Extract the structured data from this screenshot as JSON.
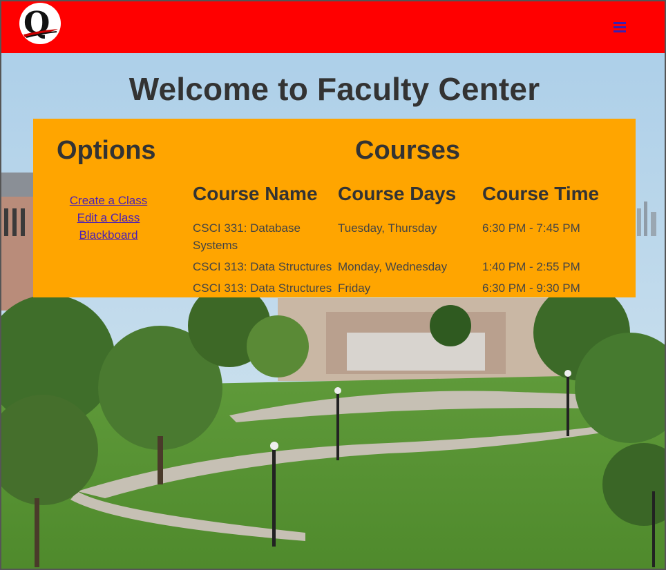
{
  "header": {
    "logo_letter": "Q",
    "menu_icon": "hamburger-menu-icon",
    "bar_color": "#ff0000"
  },
  "main": {
    "title": "Welcome to Faculty Center"
  },
  "options": {
    "title": "Options",
    "links": [
      "Create a Class",
      "Edit a Class",
      "Blackboard"
    ]
  },
  "courses": {
    "title": "Courses",
    "columns": [
      "Course Name",
      "Course Days",
      "Course Time"
    ],
    "rows": [
      [
        "CSCI 331: Database Systems",
        "Tuesday, Thursday",
        "6:30 PM - 7:45 PM"
      ],
      [
        "CSCI 313: Data Structures",
        "Monday, Wednesday",
        "1:40 PM - 2:55 PM"
      ],
      [
        "CSCI 313: Data Structures",
        "Friday",
        "6:30 PM - 9:30 PM"
      ]
    ]
  },
  "colors": {
    "panel": "#ffa500",
    "link": "#4a1fb5",
    "heading": "#333333"
  }
}
